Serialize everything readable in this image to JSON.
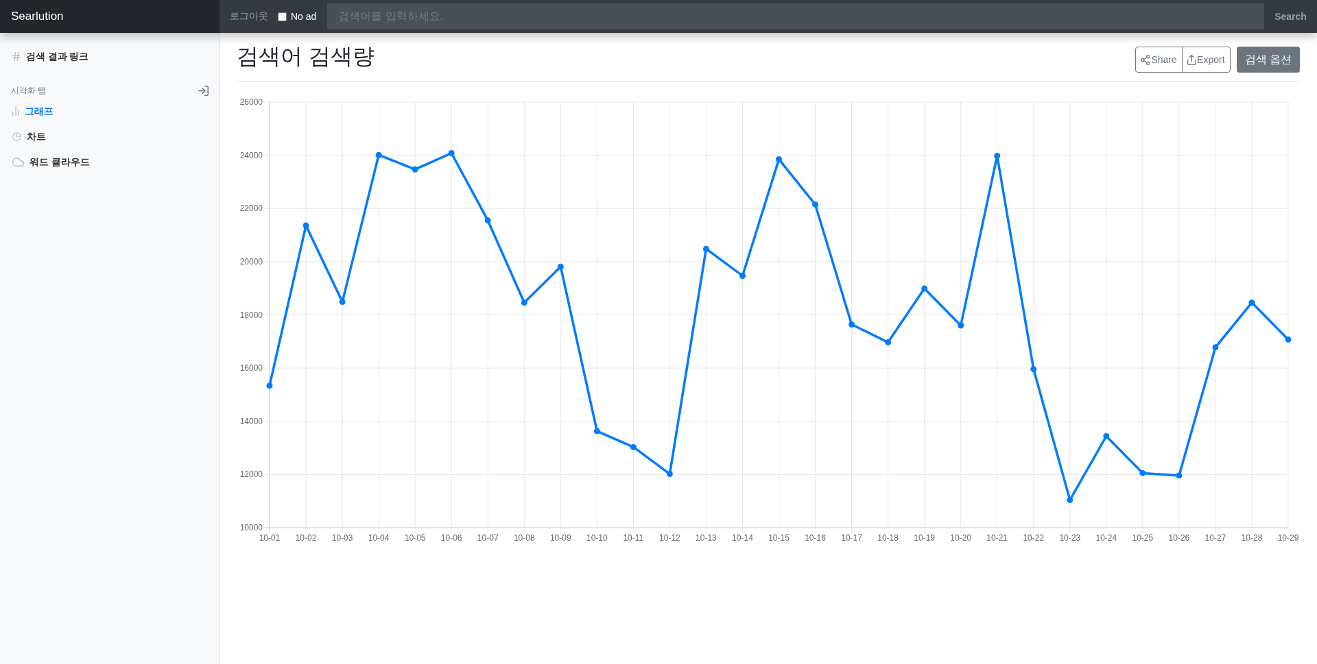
{
  "navbar": {
    "brand": "Searlution",
    "logout": "로그아웃",
    "no_ad": {
      "label": "No ad",
      "checked": false
    },
    "search": {
      "placeholder": "검색어를 입력하세요."
    },
    "search_button": "Search"
  },
  "sidebar": {
    "link": "검색 결과 링크",
    "section": {
      "heading": "시각화 탭"
    },
    "items": [
      {
        "label": "그래프",
        "kind": "bars",
        "selected": true
      },
      {
        "label": "차트",
        "kind": "pie",
        "selected": false
      },
      {
        "label": "워드 클라우드",
        "kind": "cloud",
        "selected": false
      }
    ]
  },
  "main": {
    "title": "검색어 검색량",
    "toolbar": [
      {
        "label": "Share",
        "kind": "share"
      },
      {
        "label": "Export",
        "kind": "export"
      }
    ],
    "options_button": "검색 옵션",
    "chart_data": {
      "type": "line",
      "grid": true,
      "categories": [
        "10-01",
        "10-02",
        "10-03",
        "10-04",
        "10-05",
        "10-06",
        "10-07",
        "10-08",
        "10-09",
        "10-10",
        "10-11",
        "10-12",
        "10-13",
        "10-14",
        "10-15",
        "10-16",
        "10-17",
        "10-18",
        "10-19",
        "10-20",
        "10-21",
        "10-22",
        "10-23",
        "10-24",
        "10-25",
        "10-26",
        "10-27",
        "10-28",
        "10-29"
      ],
      "series": [
        {
          "color": "#007bff",
          "marker": true,
          "values": [
            15340,
            21360,
            18490,
            24010,
            23470,
            24080,
            21550,
            18460,
            19810,
            13630,
            13030,
            12020,
            20480,
            19470,
            23850,
            22150,
            17640,
            16970,
            18990,
            17600,
            23980,
            15960,
            11040,
            13440,
            12050,
            11960,
            16780,
            18460,
            17070
          ]
        }
      ],
      "ylim": [
        10000,
        26000
      ],
      "yticks": [
        10000,
        12000,
        14000,
        16000,
        18000,
        20000,
        22000,
        24000,
        26000
      ]
    }
  }
}
